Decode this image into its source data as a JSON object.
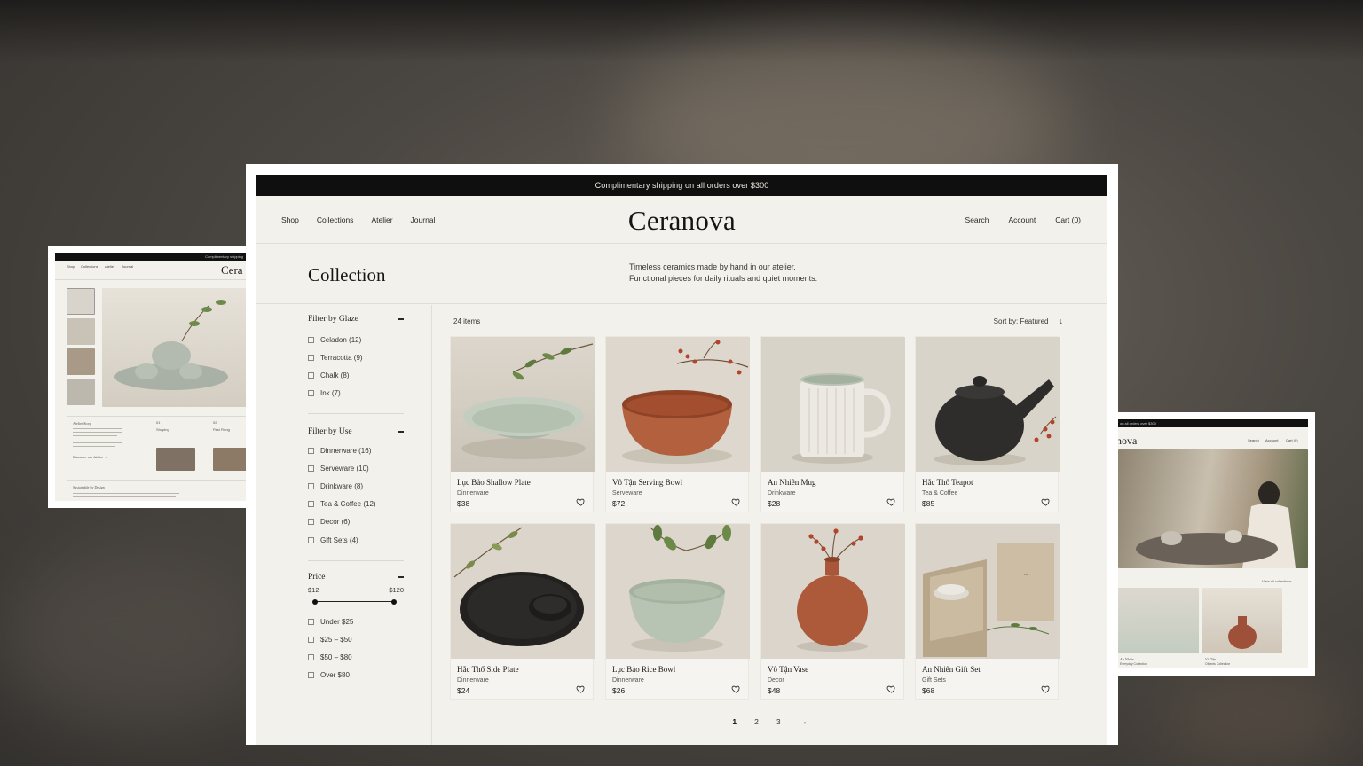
{
  "brand": "Ceranova",
  "promo": "Complimentary shipping on all orders over $300",
  "nav_left": [
    "Shop",
    "Collections",
    "Atelier",
    "Journal"
  ],
  "nav_right": [
    "Search",
    "Account",
    "Cart (0)"
  ],
  "hero": {
    "title": "Collection",
    "desc_line1": "Timeless ceramics made by hand in our atelier.",
    "desc_line2": "Functional pieces for daily rituals and quiet moments."
  },
  "filters": {
    "glaze": {
      "title": "Filter by Glaze",
      "items": [
        "Celadon (12)",
        "Terracotta (9)",
        "Chalk (8)",
        "Ink (7)"
      ]
    },
    "use": {
      "title": "Filter by Use",
      "items": [
        "Dinnerware (16)",
        "Serveware (10)",
        "Drinkware (8)",
        "Tea & Coffee (12)",
        "Decor (6)",
        "Gift Sets (4)"
      ]
    },
    "price": {
      "title": "Price",
      "min": "$12",
      "max": "$120",
      "items": [
        "Under $25",
        "$25 – $50",
        "$50 – $80",
        "Over $80"
      ]
    }
  },
  "listing": {
    "count": "24 items",
    "sort_label": "Sort by:",
    "sort_value": "Featured"
  },
  "products": [
    {
      "name": "Lục Bảo Shallow Plate",
      "category": "Dinnerware",
      "price": "$38"
    },
    {
      "name": "Vô Tận Serving Bowl",
      "category": "Serveware",
      "price": "$72"
    },
    {
      "name": "An Nhiên Mug",
      "category": "Drinkware",
      "price": "$28"
    },
    {
      "name": "Hắc Thổ Teapot",
      "category": "Tea & Coffee",
      "price": "$85"
    },
    {
      "name": "Hắc Thổ Side Plate",
      "category": "Dinnerware",
      "price": "$24"
    },
    {
      "name": "Lục Bảo Rice Bowl",
      "category": "Dinnerware",
      "price": "$26"
    },
    {
      "name": "Vô Tận Vase",
      "category": "Decor",
      "price": "$48"
    },
    {
      "name": "An Nhiên Gift Set",
      "category": "Gift Sets",
      "price": "$68"
    }
  ],
  "pagination": [
    "1",
    "2",
    "3"
  ],
  "pagination_next": "→",
  "left_preview": {
    "promo": "Complimentary shipping",
    "nav": [
      "Shop",
      "Collections",
      "Atelier",
      "Journal"
    ],
    "logo": "Cera",
    "story_title": "Atelier Story",
    "step1": "01",
    "step1_label": "Shaping",
    "step2": "02",
    "step2_label": "First Firing",
    "discover": "Discover our Atelier →",
    "sustain_title": "Sustainable by Design"
  },
  "right_preview": {
    "promo": "on all orders over $300",
    "logo": "nova",
    "nav": [
      "Search",
      "Account",
      "Cart (0)"
    ],
    "view_all": "View all collections →",
    "col1_name": "An Nhiên",
    "col1_sub": "Everyday Collection",
    "col2_name": "Vô Tận",
    "col2_sub": "Objects Collection"
  },
  "colors": {
    "background": "#f3f1ec",
    "promo_bar": "#0f0f0f",
    "celadon": "#b9c4b4",
    "terracotta": "#b5623f",
    "ink": "#2b2927",
    "chalk": "#ece9e2"
  }
}
